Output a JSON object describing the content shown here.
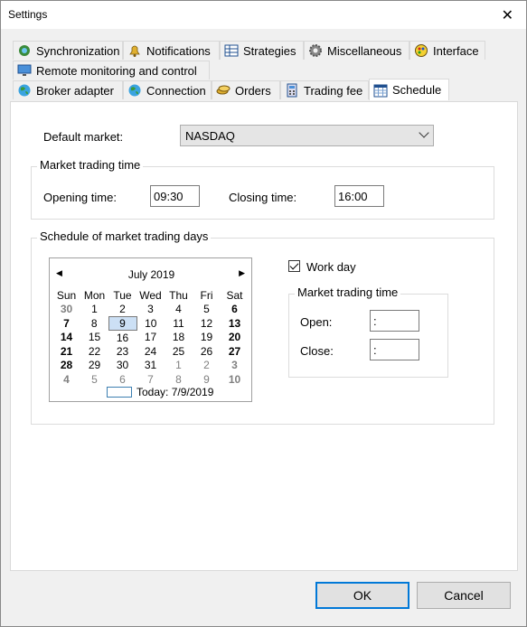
{
  "window": {
    "title": "Settings"
  },
  "tabs": {
    "row1": [
      {
        "label": "Synchronization",
        "icon": "sync-icon"
      },
      {
        "label": "Notifications",
        "icon": "bell-icon"
      },
      {
        "label": "Strategies",
        "icon": "grid-icon"
      },
      {
        "label": "Miscellaneous",
        "icon": "gear-icon"
      },
      {
        "label": "Interface",
        "icon": "palette-icon"
      }
    ],
    "row2": [
      {
        "label": "Remote monitoring and control",
        "icon": "monitor-icon"
      }
    ],
    "row3": [
      {
        "label": "Broker adapter",
        "icon": "globe-icon"
      },
      {
        "label": "Connection",
        "icon": "globe-icon"
      },
      {
        "label": "Orders",
        "icon": "coins-icon"
      },
      {
        "label": "Trading fee",
        "icon": "calculator-icon"
      },
      {
        "label": "Schedule",
        "icon": "calendar-icon",
        "active": true
      }
    ]
  },
  "schedule": {
    "default_market_label": "Default market:",
    "default_market_value": "NASDAQ",
    "market_trading_time_title": "Market trading time",
    "opening_time_label": "Opening time:",
    "opening_time_value": "09:30",
    "closing_time_label": "Closing time:",
    "closing_time_value": "16:00",
    "trading_days_title": "Schedule of market trading days",
    "calendar": {
      "month": "July 2019",
      "weekdays": [
        "Sun",
        "Mon",
        "Tue",
        "Wed",
        "Thu",
        "Fri",
        "Sat"
      ],
      "weeks": [
        [
          "30",
          "1",
          "2",
          "3",
          "4",
          "5",
          "6"
        ],
        [
          "7",
          "8",
          "9",
          "10",
          "11",
          "12",
          "13"
        ],
        [
          "14",
          "15",
          "16",
          "17",
          "18",
          "19",
          "20"
        ],
        [
          "21",
          "22",
          "23",
          "24",
          "25",
          "26",
          "27"
        ],
        [
          "28",
          "29",
          "30",
          "31",
          "1",
          "2",
          "3"
        ],
        [
          "4",
          "5",
          "6",
          "7",
          "8",
          "9",
          "10"
        ]
      ],
      "selected": "9",
      "today_label": "Today: 7/9/2019"
    },
    "work_day_label": "Work day",
    "work_day_checked": true,
    "day_trading_time_title": "Market trading time",
    "open_label": "Open:",
    "open_value": ":",
    "close_label": "Close:",
    "close_value": ":"
  },
  "buttons": {
    "ok": "OK",
    "cancel": "Cancel"
  }
}
